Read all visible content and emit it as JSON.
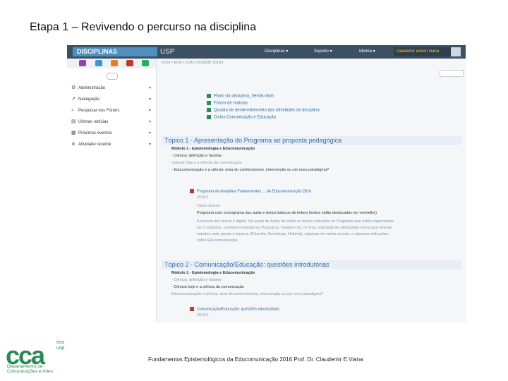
{
  "slide": {
    "title": "Etapa 1 – Revivendo o percurso na disciplina",
    "footer": "Fundamentos Epistemológicos da Educomunicação 2016 Prof. Dr. Claudemir E.Viana"
  },
  "logo": {
    "main": "cca",
    "eco": "eco",
    "usp": "usp",
    "dept_line1": "Departamento de",
    "dept_line2": "Comunicações e Artes"
  },
  "topbar": {
    "brand": "DISCIPLINAS",
    "usp": "USP",
    "menu": [
      "Disciplinas",
      "Suporte",
      "Idioma"
    ],
    "user": "claudemir edson viana"
  },
  "sidebar": {
    "items": [
      {
        "icon": "gear-icon",
        "label": "Administração"
      },
      {
        "icon": "navigation-icon",
        "label": "Navegação"
      },
      {
        "icon": "search-icon",
        "label": "Pesquisar nos Fóruns"
      },
      {
        "icon": "calendar-icon",
        "label": "Últimas notícias"
      },
      {
        "icon": "calendar-icon",
        "label": "Próximos eventos"
      },
      {
        "icon": "activity-icon",
        "label": "Atividade recente"
      }
    ]
  },
  "main": {
    "breadcrumb": "Início  >  ECA  >  CCA  >  CCA0287 2016/1",
    "resources": [
      "Plano da disciplina_Versão final",
      "Fórum de notícias",
      "Quadro de desenvolvimento das atividades da disciplina",
      "Ciclos Comunicação e Educação"
    ],
    "section1": {
      "title": "Tópico 1 - Apresentação do Programa ao proposta pedagógica",
      "lines": [
        "Módulo 1 - Epistemologia e Educomunicação",
        "- Ciência: definição e história",
        "Ciência hoje e a ciência da comunicação",
        "- Educomunicação e a ciência: área do conhecimento, intervenção ou um novo paradigma?"
      ],
      "file": "Programa da disciplina Fundamentos ... da Educomunicação 2016",
      "file_meta": "2016/1",
      "notes": [
        "Caros alunos",
        "Programa com cronograma das aulas e textos básicos de leitura (textos estão destacados em vermelho)",
        "A maioria dos textos é digital. Na pasta de Aulas há todos os textos indicados no Programa que estão organizados",
        "em 3 módulos, conforme indicado no Programa. Também há, no final, indicação de bibliografia extra para orientar",
        "estudos mais gerais e básicos (Filosofia, Sociologia, História), algumas de minha autoria, e algumas indicações",
        "sobre Educomunicação."
      ]
    },
    "section2": {
      "title": "Tópico 2 - Comunicação/Educação: questões introdutórias",
      "lines": [
        "Módulo 1 - Epistemologia e Educomunicação",
        "- Ciência: definição e história",
        "- Ciência hoje e a ciência da comunicação",
        "Educomunicação e ciência: área do conhecimento, intervenção ou um novo paradigma?"
      ],
      "file": "Comunicação/Educação: questões introdutórias",
      "file_meta": "2016/1"
    }
  },
  "colors": {
    "topbar": "#3d5062",
    "accent": "#4f8fc0",
    "section_header": "#e7eef6",
    "logo_green": "#2a8a55"
  }
}
